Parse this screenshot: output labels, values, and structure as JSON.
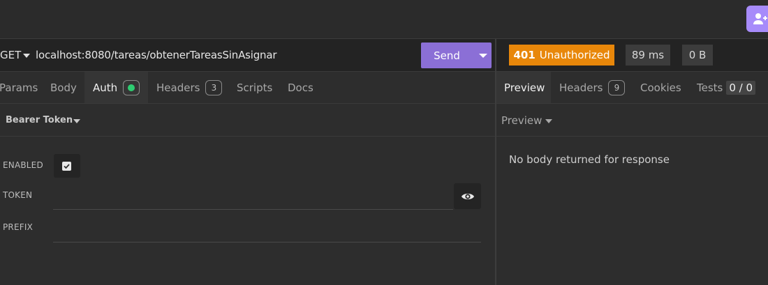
{
  "request": {
    "method": "GET",
    "url": "localhost:8080/tareas/obtenerTareasSinAsignar",
    "send_label": "Send",
    "tabs": [
      {
        "label": "Params"
      },
      {
        "label": "Body"
      },
      {
        "label": "Auth",
        "active": true
      },
      {
        "label": "Headers",
        "count": "3"
      },
      {
        "label": "Scripts"
      },
      {
        "label": "Docs"
      }
    ],
    "auth": {
      "type_label": "Bearer Token",
      "enabled_label": "ENABLED",
      "enabled": true,
      "token_label": "TOKEN",
      "token_value": "",
      "prefix_label": "PREFIX",
      "prefix_value": ""
    }
  },
  "response": {
    "status_code": "401",
    "status_text": "Unauthorized",
    "time": "89 ms",
    "size": "0 B",
    "tabs": [
      {
        "label": "Preview",
        "active": true
      },
      {
        "label": "Headers",
        "count": "9"
      },
      {
        "label": "Cookies"
      },
      {
        "label": "Tests",
        "count": "0 / 0"
      }
    ],
    "preview_mode": "Preview",
    "empty_message": "No body returned for response"
  },
  "colors": {
    "accent": "#8b6fd6",
    "status_error": "#e8870a",
    "auth_active_dot": "#2ecc71"
  },
  "icons": [
    "user-plus-icon",
    "caret-down-icon",
    "check-icon",
    "eye-icon"
  ]
}
